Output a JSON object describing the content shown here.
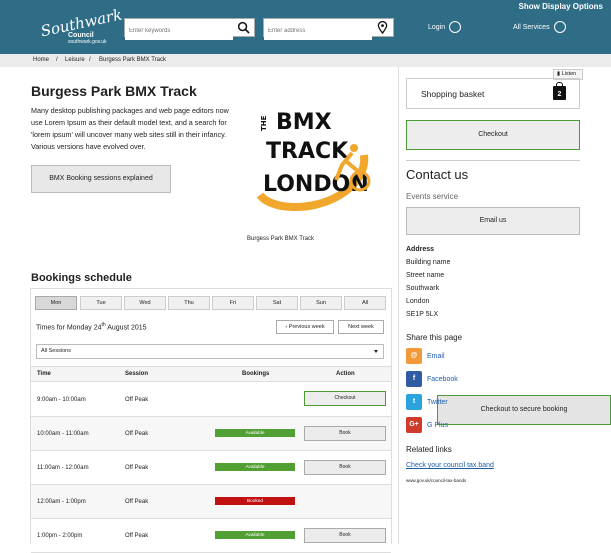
{
  "header": {
    "show_display": "Show Display Options",
    "logo_name": "Southwark",
    "logo_council": "Council",
    "logo_url": "southwark.gov.uk",
    "keywords_placeholder": "Enter keywords",
    "address_placeholder": "Enter address",
    "login": "Login",
    "all_services": "All Services",
    "colors": {
      "brand": "#2f6d87"
    }
  },
  "breadcrumb": [
    "Home",
    "/",
    "Leisure",
    "/",
    "Burgess Park BMX Track"
  ],
  "page": {
    "title": "Burgess Park BMX Track",
    "intro": "Many desktop publishing packages and web page editors now use Lorem Ipsum as their default model text, and a search for 'lorem ipsum' will uncover many web sites still in their infancy. Various versions have evolved over.",
    "bmx_button": "BMX Booking sessions explained",
    "logo_line1": "THE",
    "logo_line2": "BMX",
    "logo_line3": "TRACK",
    "logo_line4": "LONDON",
    "caption": "Burgess Park BMX Track"
  },
  "schedule": {
    "heading": "Bookings schedule",
    "days": [
      "Mon",
      "Tue",
      "Wed",
      "Thu",
      "Fri",
      "Sat",
      "Sun",
      "All"
    ],
    "times_label": "Times for Monday 24",
    "times_sup": "th",
    "times_rest": " August 2015",
    "prev_week": "Previous week",
    "next_week": "Next week",
    "filter_value": "All Sessions",
    "columns": [
      "Time",
      "Session",
      "Bookings",
      "Action"
    ],
    "rows": [
      {
        "time": "9:00am - 10:00am",
        "session": "Off Peak",
        "status": "Checkout to secure booking",
        "action": "Checkout"
      },
      {
        "time": "10:00am - 11:00am",
        "session": "Off Peak",
        "status": "Available",
        "action": "Book"
      },
      {
        "time": "11:00am - 12:00am",
        "session": "Off Peak",
        "status": "Available",
        "action": "Book"
      },
      {
        "time": "12:00am - 1:00pm",
        "session": "Off Peak",
        "status": "Booked",
        "action": ""
      },
      {
        "time": "1:00pm - 2:00pm",
        "session": "Off Peak",
        "status": "Available",
        "action": "Book"
      }
    ]
  },
  "sidebar": {
    "listen": "Listen",
    "basket": "Shopping basket",
    "basket_count": "2",
    "checkout": "Checkout",
    "contact_heading": "Contact us",
    "events_service": "Events service",
    "email_us": "Email us",
    "address_label": "Address",
    "address": [
      "Building name",
      "Street name",
      "Southwark",
      "London",
      "SE1P 5LX"
    ],
    "share_heading": "Share this page",
    "share": [
      "Email",
      "Facebook",
      "Twitter",
      "G Plus"
    ],
    "related_heading": "Related links",
    "related_link": "Check your council tax band",
    "related_url": "www.gov.uk/council-tax-bands"
  }
}
